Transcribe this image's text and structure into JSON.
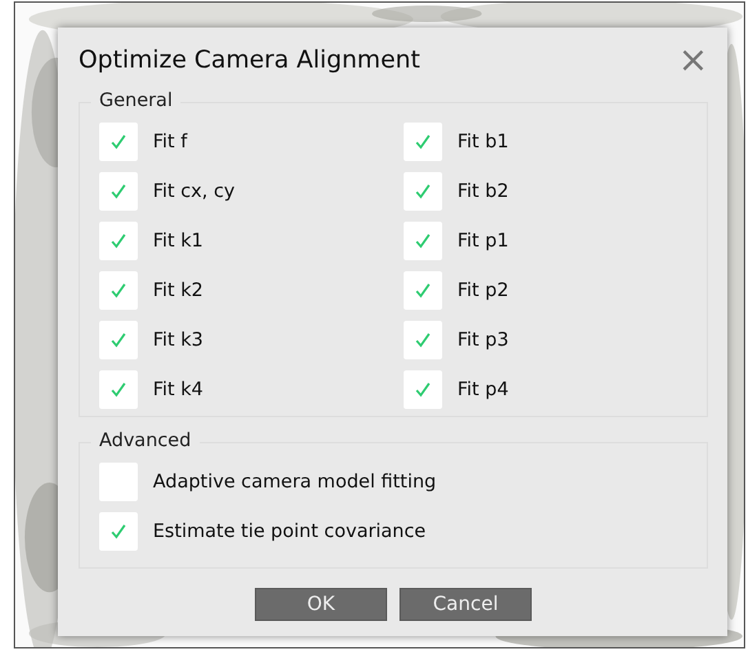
{
  "dialog": {
    "title": "Optimize Camera Alignment",
    "close": "×"
  },
  "general": {
    "title": "General",
    "columns": [
      [
        {
          "label": "Fit f",
          "checked": true
        },
        {
          "label": "Fit cx, cy",
          "checked": true
        },
        {
          "label": "Fit k1",
          "checked": true
        },
        {
          "label": "Fit k2",
          "checked": true
        },
        {
          "label": "Fit k3",
          "checked": true
        },
        {
          "label": "Fit k4",
          "checked": true
        }
      ],
      [
        {
          "label": "Fit b1",
          "checked": true
        },
        {
          "label": "Fit b2",
          "checked": true
        },
        {
          "label": "Fit p1",
          "checked": true
        },
        {
          "label": "Fit p2",
          "checked": true
        },
        {
          "label": "Fit p3",
          "checked": true
        },
        {
          "label": "Fit p4",
          "checked": true
        }
      ]
    ]
  },
  "advanced": {
    "title": "Advanced",
    "items": [
      {
        "label": "Adaptive camera model fitting",
        "checked": false
      },
      {
        "label": "Estimate tie point covariance",
        "checked": true
      }
    ]
  },
  "buttons": [
    "OK",
    "Cancel"
  ]
}
